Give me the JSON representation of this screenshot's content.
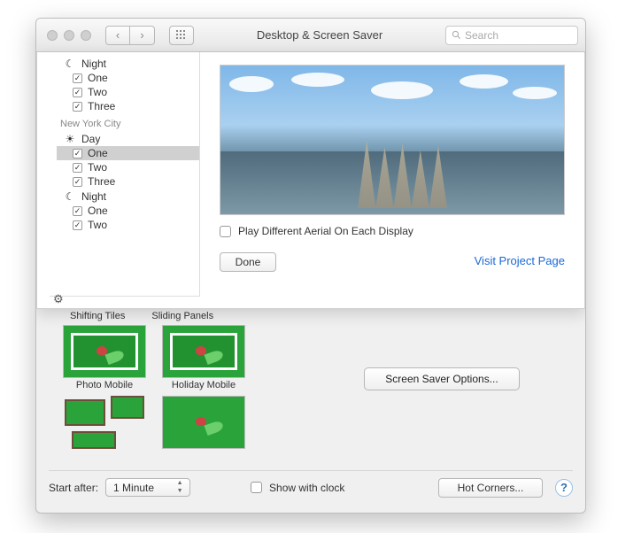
{
  "titlebar": {
    "title": "Desktop & Screen Saver",
    "search_placeholder": "Search"
  },
  "sheet": {
    "sections": [
      {
        "icon": "moon",
        "label": "Night",
        "items": [
          {
            "label": "One",
            "checked": true
          },
          {
            "label": "Two",
            "checked": true
          },
          {
            "label": "Three",
            "checked": true
          }
        ]
      }
    ],
    "city_header": "New York City",
    "day": {
      "icon": "sun",
      "label": "Day",
      "items": [
        {
          "label": "One",
          "checked": true,
          "selected": true
        },
        {
          "label": "Two",
          "checked": true
        },
        {
          "label": "Three",
          "checked": true
        }
      ]
    },
    "night2": {
      "icon": "moon",
      "label": "Night",
      "items": [
        {
          "label": "One",
          "checked": true
        },
        {
          "label": "Two",
          "checked": true
        }
      ]
    },
    "play_each_display": {
      "label": "Play Different Aerial On Each Display",
      "checked": false
    },
    "done_label": "Done",
    "link_label": "Visit Project Page"
  },
  "grid": {
    "col_labels": [
      "Shifting Tiles",
      "Sliding Panels"
    ],
    "row2_labels": [
      "Photo Mobile",
      "Holiday Mobile"
    ]
  },
  "options_button": "Screen Saver Options...",
  "bottom": {
    "start_label": "Start after:",
    "start_value": "1 Minute",
    "show_clock": {
      "label": "Show with clock",
      "checked": false
    },
    "hot_corners": "Hot Corners...",
    "help": "?"
  }
}
